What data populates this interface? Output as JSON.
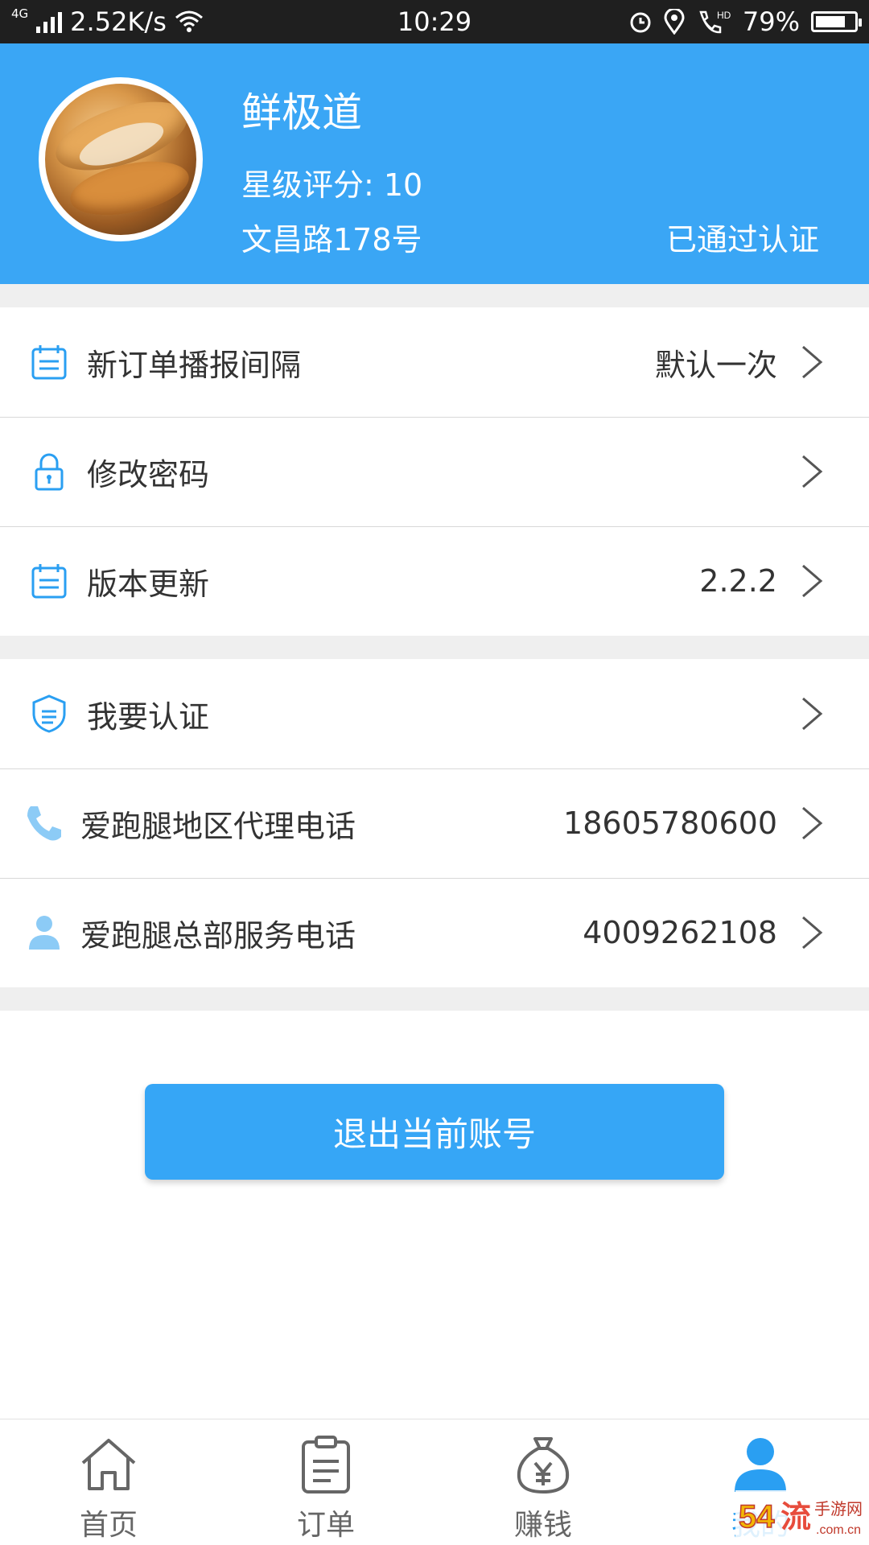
{
  "status_bar": {
    "network": "4G",
    "speed": "2.52K/s",
    "time": "10:29",
    "hd": "HD",
    "battery": "79%",
    "battery_level": 0.79
  },
  "header": {
    "shop_name": "鲜极道",
    "rating": "星级评分: 10",
    "address": "文昌路178号",
    "cert_status": "已通过认证",
    "bg_color": "#3aa6f5"
  },
  "settings": [
    {
      "label": "新订单播报间隔",
      "value": "默认一次",
      "icon": "calendar-icon"
    },
    {
      "label": "修改密码",
      "value": "",
      "icon": "lock-icon"
    },
    {
      "label": "版本更新",
      "value": "2.2.2",
      "icon": "calendar-icon"
    }
  ],
  "services": [
    {
      "label": "我要认证",
      "value": "",
      "icon": "shield-icon"
    },
    {
      "label": "爱跑腿地区代理电话",
      "value": "18605780600",
      "icon": "phone-icon"
    },
    {
      "label": "爱跑腿总部服务电话",
      "value": "4009262108",
      "icon": "user-icon"
    }
  ],
  "logout_label": "退出当前账号",
  "tabs": [
    {
      "label": "首页",
      "icon": "home-icon"
    },
    {
      "label": "订单",
      "icon": "clipboard-icon"
    },
    {
      "label": "赚钱",
      "icon": "money-bag-icon"
    },
    {
      "label": "我的",
      "icon": "user-icon"
    }
  ],
  "watermark": "54流手游网 .com.cn",
  "colors": {
    "accent": "#3aa6f5",
    "icon_blue": "#2a9ff2",
    "divider": "#d8d8d8"
  }
}
